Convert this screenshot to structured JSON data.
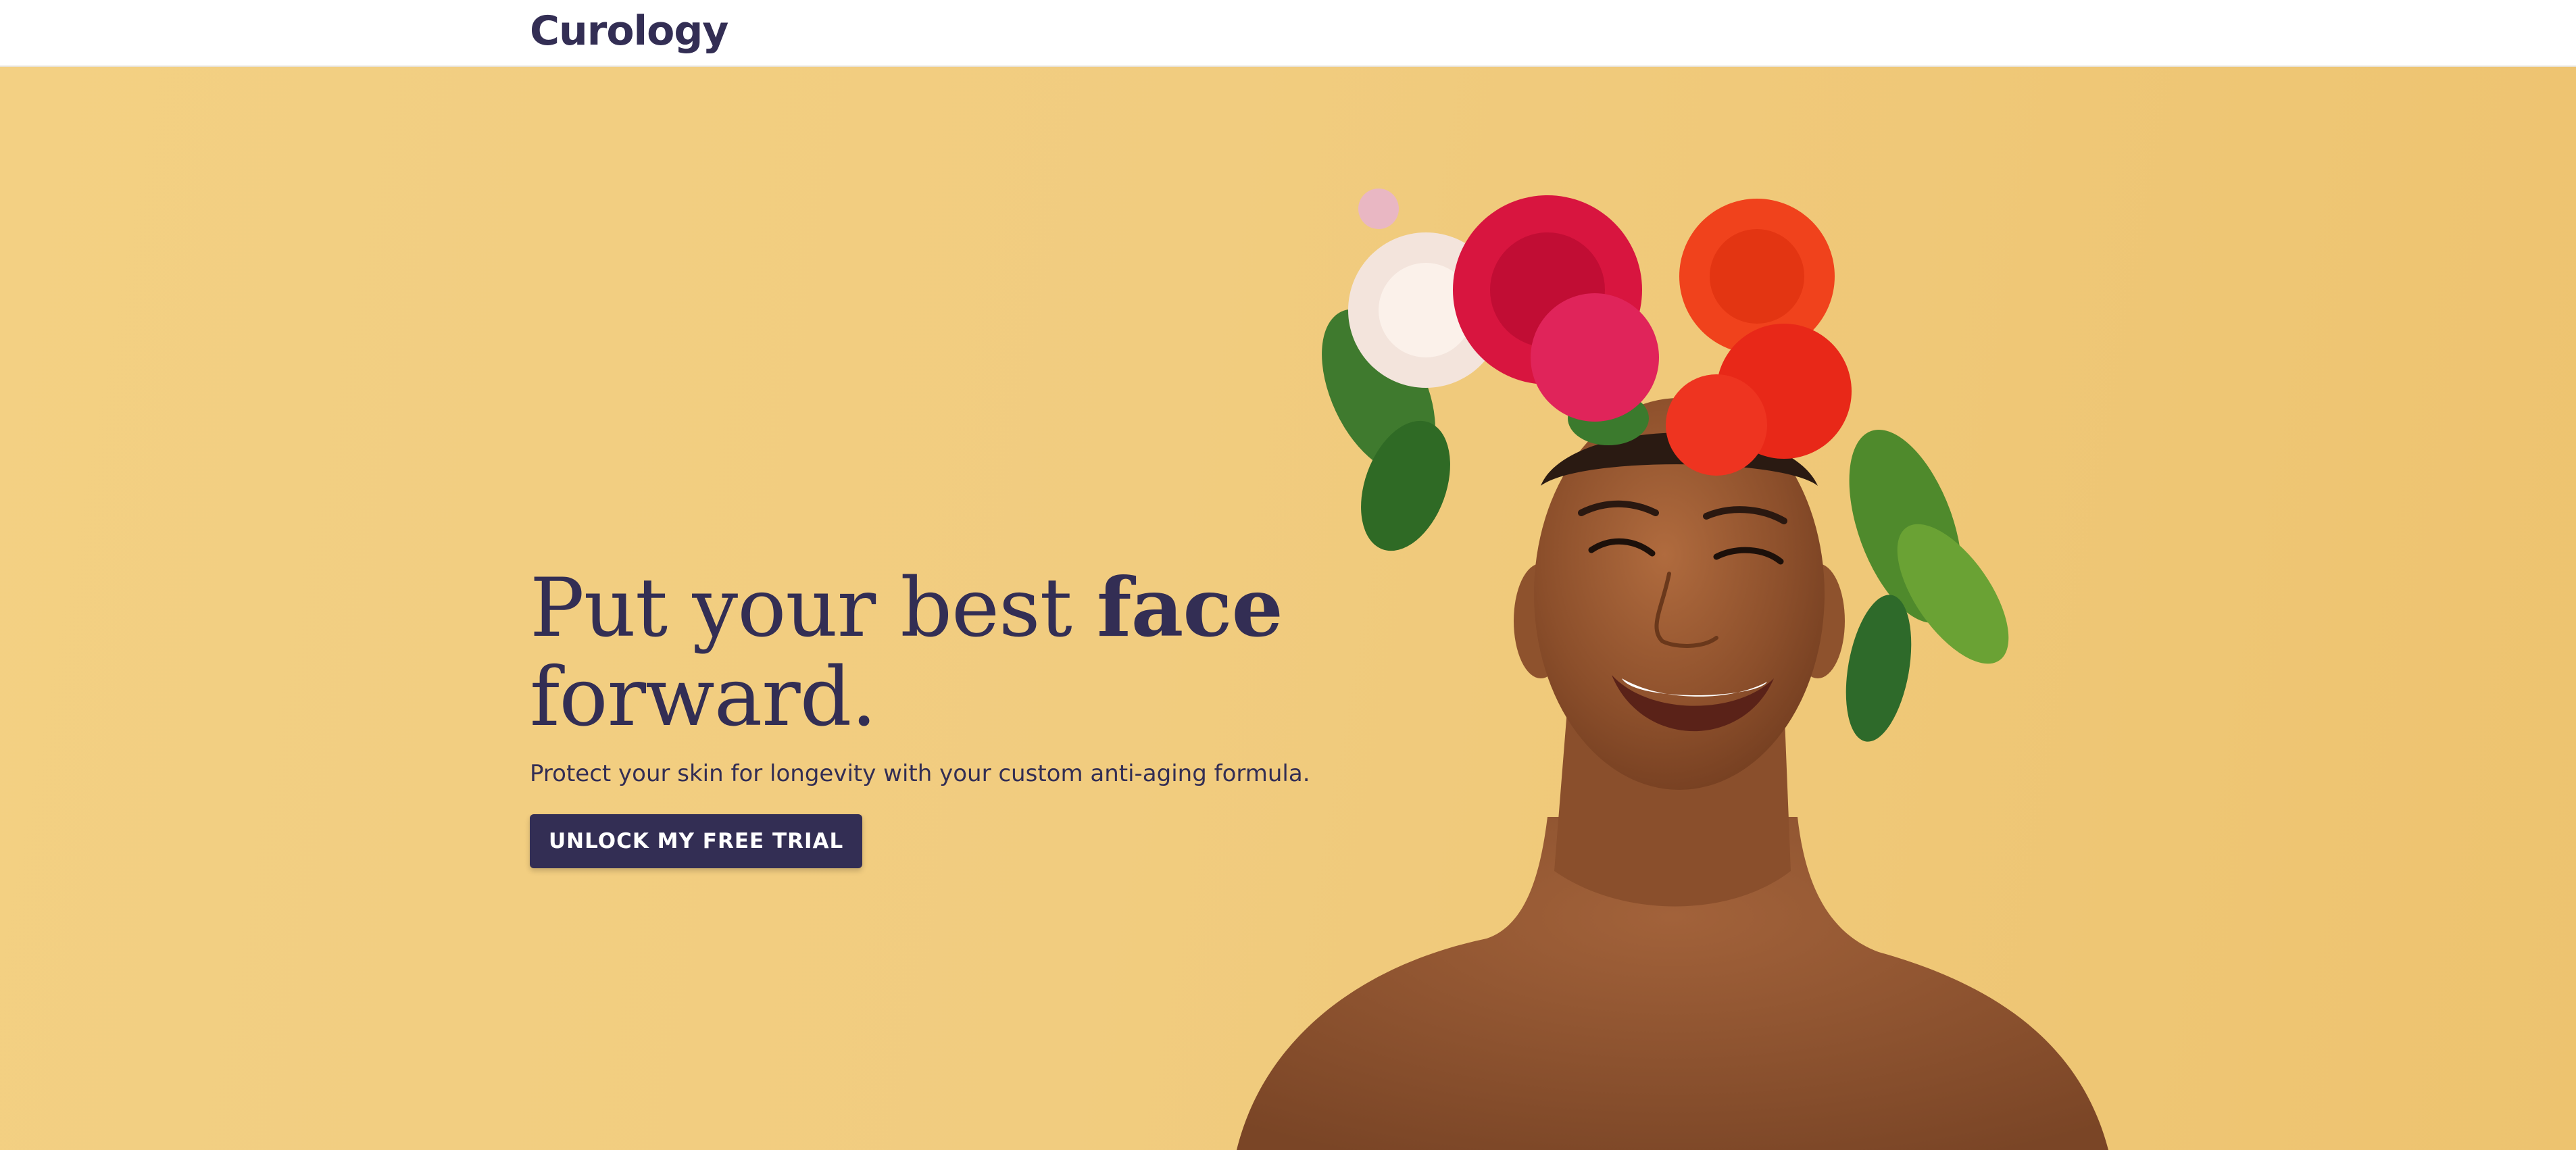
{
  "header": {
    "logo_text": "Curology"
  },
  "hero": {
    "headline_regular": "Put your best ",
    "headline_bold": "face",
    "headline_line2": "forward.",
    "subtext": "Protect your skin for longevity with your custom anti-aging formula.",
    "cta_label": "UNLOCK MY FREE TRIAL"
  },
  "colors": {
    "brand_navy": "#332e54",
    "hero_background": "#f1cc7f",
    "header_background": "#ffffff"
  }
}
